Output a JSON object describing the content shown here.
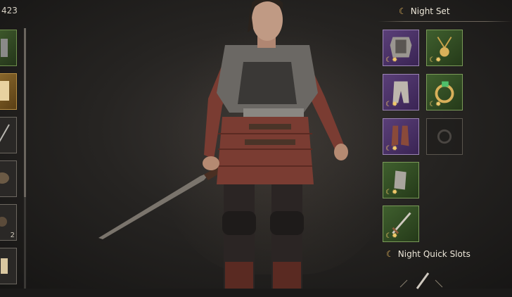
{
  "currency": {
    "amount": "423"
  },
  "equipment_panel": {
    "title": "Night Set",
    "quick_slots_title": "Night Quick Slots",
    "slots": [
      {
        "name": "chest-armor",
        "rarity": "purple",
        "icon": "chainmail-icon"
      },
      {
        "name": "amulet",
        "rarity": "green",
        "icon": "amulet-icon"
      },
      {
        "name": "leg-armor",
        "rarity": "purple",
        "icon": "pants-icon"
      },
      {
        "name": "ring",
        "rarity": "green",
        "icon": "ring-icon"
      },
      {
        "name": "boots",
        "rarity": "purple",
        "icon": "boots-icon"
      },
      {
        "name": "ring-empty",
        "rarity": "empty",
        "icon": "empty-ring-icon"
      },
      {
        "name": "bracers",
        "rarity": "green",
        "icon": "bracer-icon"
      },
      {
        "name": "weapon",
        "rarity": "green",
        "icon": "sword-icon"
      }
    ]
  },
  "inventory_sidebar": {
    "items": [
      {
        "icon": "armor-piece-icon",
        "rarity": "green",
        "count": ""
      },
      {
        "icon": "scroll-icon",
        "rarity": "gold",
        "count": ""
      },
      {
        "icon": "sword-icon",
        "rarity": "grey",
        "count": ""
      },
      {
        "icon": "helmet-icon",
        "rarity": "grey",
        "count": ""
      },
      {
        "icon": "potion-icon",
        "rarity": "grey",
        "count": "2"
      },
      {
        "icon": "cloth-icon",
        "rarity": "grey",
        "count": ""
      }
    ]
  },
  "colors": {
    "accent": "#e3b55c",
    "purple_rarity": "#5a3f78",
    "green_rarity": "#3f5f2e"
  }
}
